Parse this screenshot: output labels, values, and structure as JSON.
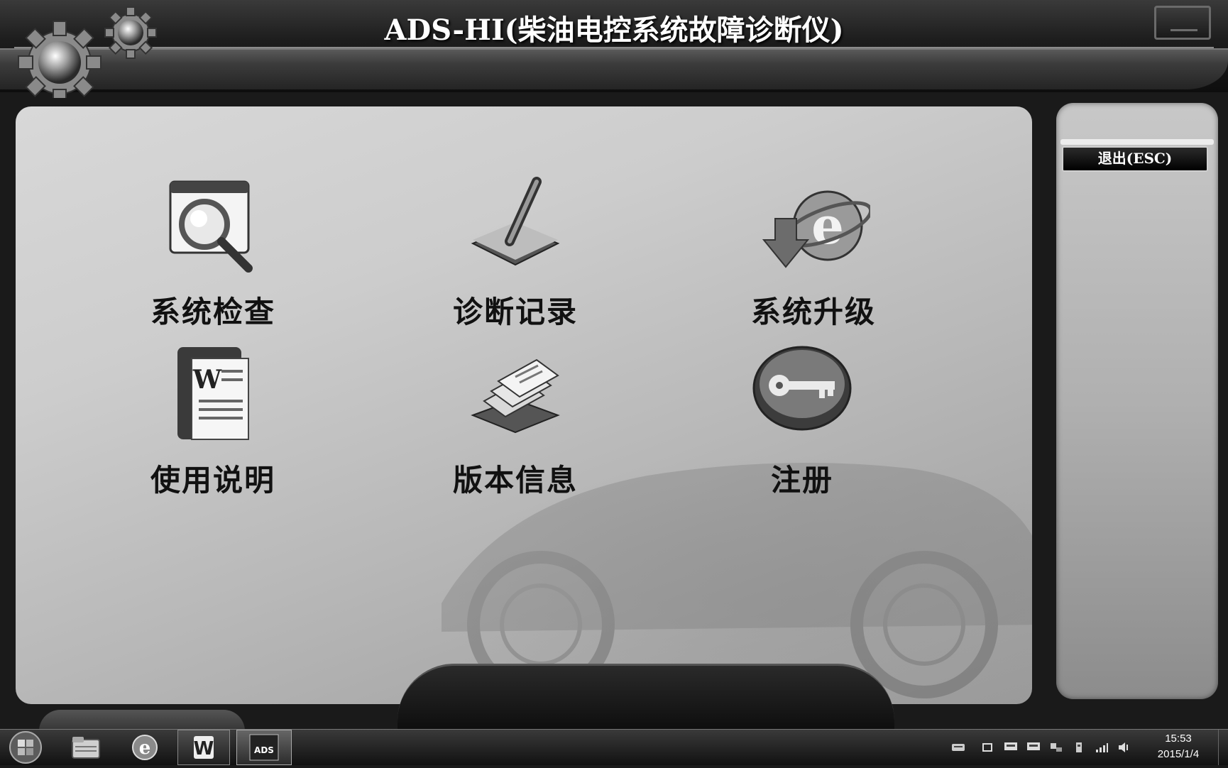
{
  "window": {
    "title": "ADS-HI(柴油电控系统故障诊断仪)"
  },
  "menu": {
    "items": [
      {
        "id": "system-check",
        "label": "系统检查",
        "icon": "magnifier-window-icon"
      },
      {
        "id": "diagnosis-records",
        "label": "诊断记录",
        "icon": "pen-document-icon"
      },
      {
        "id": "system-upgrade",
        "label": "系统升级",
        "icon": "ie-download-icon"
      },
      {
        "id": "user-manual",
        "label": "使用说明",
        "icon": "word-document-icon"
      },
      {
        "id": "version-info",
        "label": "版本信息",
        "icon": "stacked-papers-icon"
      },
      {
        "id": "register",
        "label": "注册",
        "icon": "key-icon"
      }
    ]
  },
  "side_panel": {
    "exit_label": "退出(ESC)"
  },
  "taskbar": {
    "apps": [
      {
        "name": "start-button"
      },
      {
        "name": "file-explorer-icon"
      },
      {
        "name": "internet-explorer-icon"
      },
      {
        "name": "w-app-icon"
      },
      {
        "name": "ads-app-icon",
        "label": "ADS"
      }
    ],
    "clock": {
      "time": "15:53",
      "date": "2015/1/4"
    }
  }
}
